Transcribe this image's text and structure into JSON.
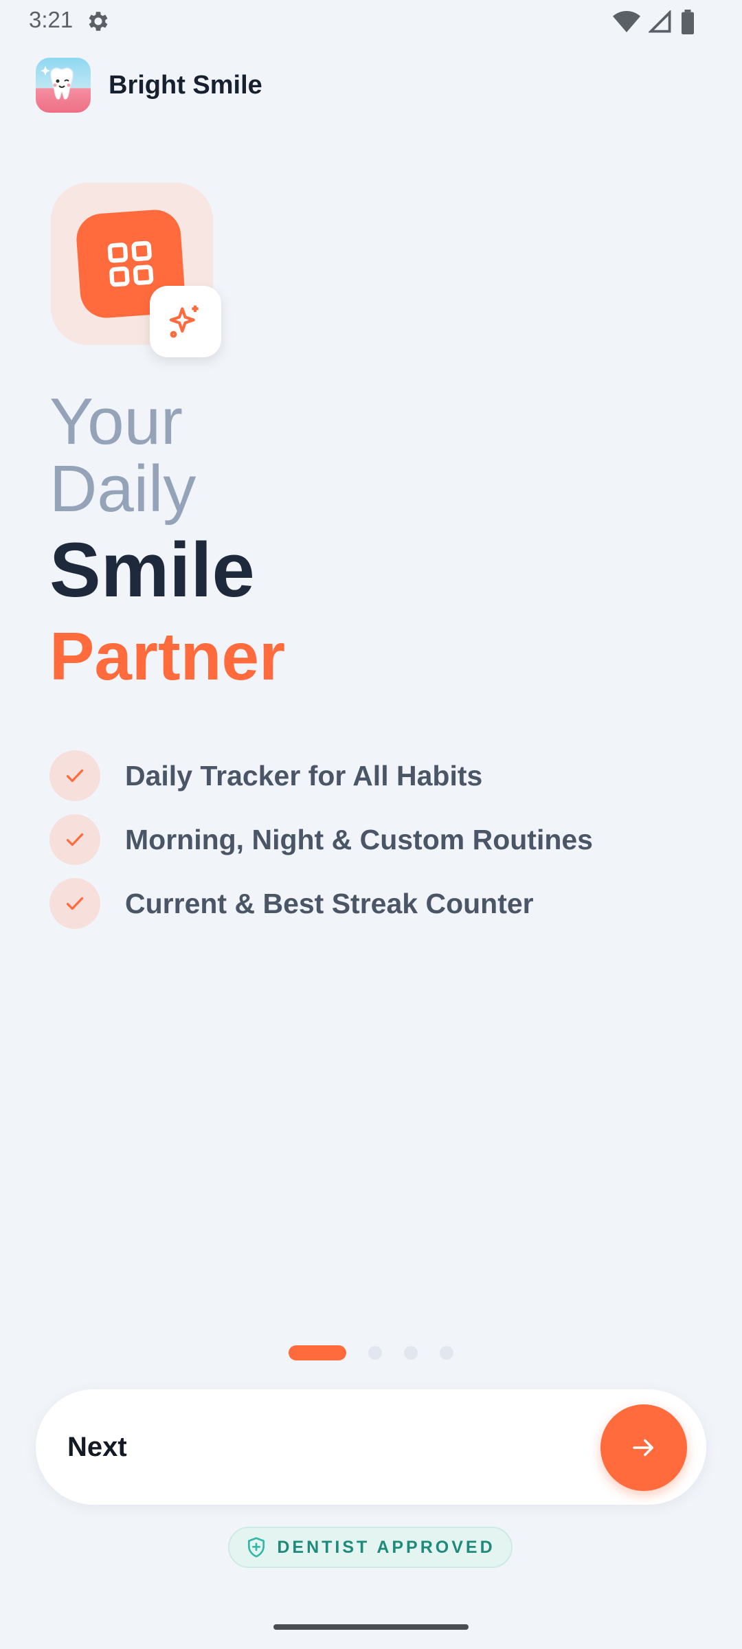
{
  "status_bar": {
    "time": "3:21"
  },
  "header": {
    "app_name": "Bright Smile"
  },
  "headline": {
    "line1": "Your",
    "line2": "Daily",
    "line3": "Smile",
    "line4": "Partner"
  },
  "features": [
    "Daily Tracker for All Habits",
    "Morning, Night & Custom Routines",
    "Current & Best Streak Counter"
  ],
  "pager": {
    "total": 4,
    "current": 1
  },
  "next_button": {
    "label": "Next"
  },
  "badge": {
    "text": "DENTIST APPROVED"
  },
  "colors": {
    "accent": "#FF6B3D",
    "background": "#F1F4F9",
    "heading_dark": "#1E293B",
    "heading_light": "#94A3B8",
    "badge_teal": "#1E8A7A"
  },
  "icons": {
    "status": [
      "gear-icon",
      "wifi-icon",
      "signal-icon",
      "battery-icon"
    ],
    "hero": "grid-icon",
    "hero_badge": "sparkle-icon",
    "feature_check": "check-icon",
    "next": "arrow-right-icon",
    "badge": "shield-plus-icon"
  }
}
